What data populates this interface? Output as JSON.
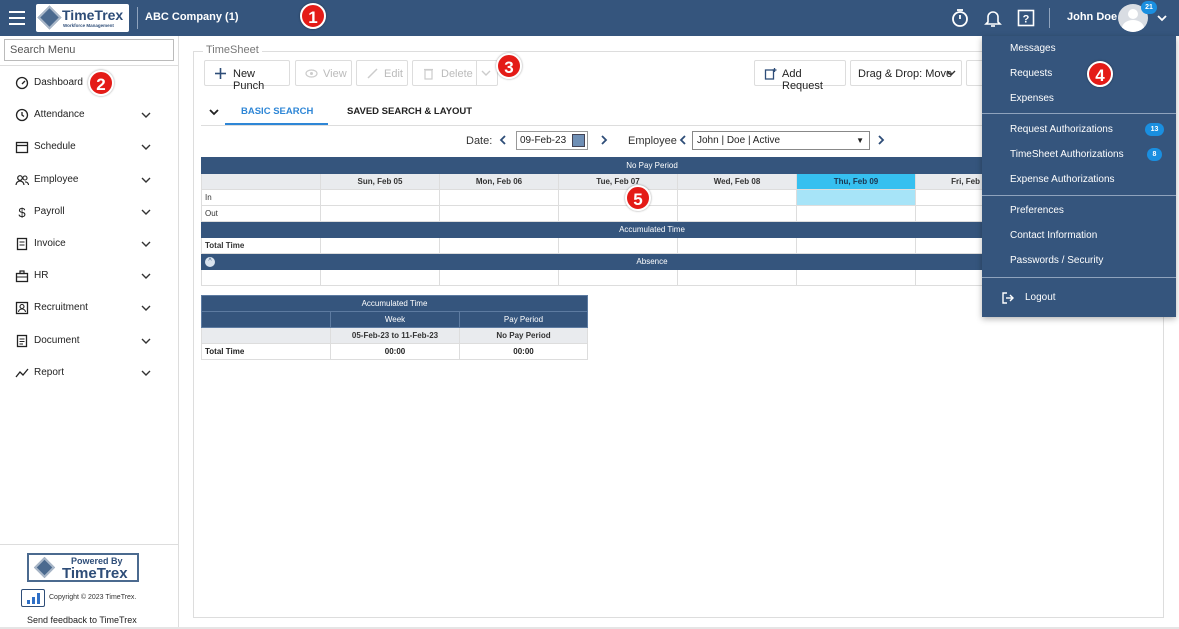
{
  "header": {
    "logo_text": "TimeTrex",
    "logo_subtext": "Workforce Management",
    "company": "ABC Company (1)",
    "user_name": "John Doe",
    "notification_count": "21",
    "icons": [
      "menu-icon",
      "timer-icon",
      "bell-icon",
      "help-icon",
      "avatar",
      "chevron-down-icon"
    ]
  },
  "markers": {
    "m1": "1",
    "m2": "2",
    "m3": "3",
    "m4": "4",
    "m5": "5"
  },
  "sidebar": {
    "search_placeholder": "Search Menu",
    "items": [
      {
        "label": "Dashboard",
        "icon": "gauge-icon"
      },
      {
        "label": "Attendance",
        "icon": "clock-icon"
      },
      {
        "label": "Schedule",
        "icon": "calendar-icon"
      },
      {
        "label": "Employee",
        "icon": "users-icon"
      },
      {
        "label": "Payroll",
        "icon": "dollar-icon"
      },
      {
        "label": "Invoice",
        "icon": "invoice-icon"
      },
      {
        "label": "HR",
        "icon": "briefcase-icon"
      },
      {
        "label": "Recruitment",
        "icon": "recruitment-icon"
      },
      {
        "label": "Document",
        "icon": "document-icon"
      },
      {
        "label": "Report",
        "icon": "chart-line-icon"
      }
    ],
    "powered_by": "Powered By",
    "powered_brand": "TimeTrex",
    "copyright": "Copyright © 2023 TimeTrex.",
    "feedback": "Send feedback to TimeTrex"
  },
  "main": {
    "panel_title": "TimeSheet",
    "toolbar": {
      "new_punch": "New Punch",
      "view": "View",
      "edit": "Edit",
      "delete": "Delete",
      "add_request": "Add Request",
      "drag_drop": "Drag & Drop: Move"
    },
    "tabs": {
      "basic": "BASIC SEARCH",
      "saved": "SAVED SEARCH & LAYOUT"
    },
    "filters": {
      "date_label": "Date:",
      "date_value": "09-Feb-23",
      "employee_label": "Employee",
      "employee_value": "John | Doe | Active"
    },
    "grid": {
      "pay_period": "No Pay Period",
      "days": [
        "Sun, Feb 05",
        "Mon, Feb 06",
        "Tue, Feb 07",
        "Wed, Feb 08",
        "Thu, Feb 09",
        "Fri, Feb"
      ],
      "row_in": "In",
      "row_out": "Out",
      "accumulated": "Accumulated Time",
      "total_time": "Total Time",
      "absence": "Absence"
    },
    "accumulated_table": {
      "title": "Accumulated Time",
      "col_week": "Week",
      "col_pay_period": "Pay Period",
      "week_range": "05-Feb-23 to 11-Feb-23",
      "pay_period_value": "No Pay Period",
      "row_label": "Total Time",
      "week_total": "00:00",
      "pay_period_total": "00:00"
    }
  },
  "user_menu": {
    "items": [
      {
        "label": "Messages"
      },
      {
        "label": "Requests"
      },
      {
        "label": "Expenses"
      },
      {
        "label": "Request Authorizations",
        "badge": "13"
      },
      {
        "label": "TimeSheet Authorizations",
        "badge": "8"
      },
      {
        "label": "Expense Authorizations"
      },
      {
        "label": "Preferences"
      },
      {
        "label": "Contact Information"
      },
      {
        "label": "Passwords / Security"
      },
      {
        "label": "Logout"
      }
    ]
  },
  "colors": {
    "header": "#35557d",
    "accent": "#2e86d6",
    "marker": "#e41b17",
    "today": "#36c0f0"
  }
}
